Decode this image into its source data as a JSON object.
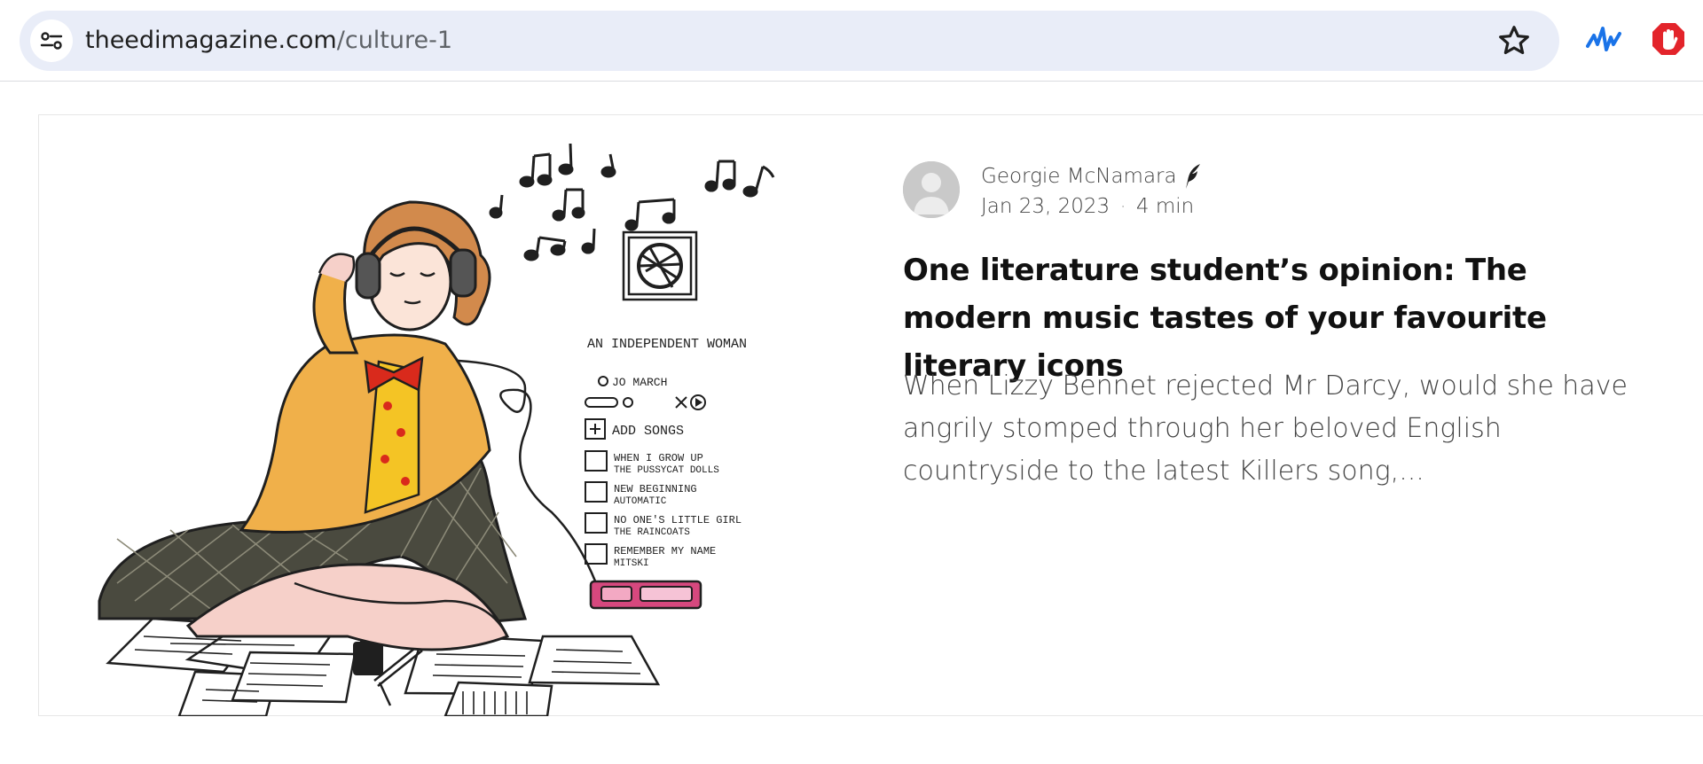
{
  "browser": {
    "url_host": "theedimagazine.com",
    "url_path": "/culture-1",
    "icons": {
      "site_settings": "tune-icon",
      "bookmark": "star-icon",
      "extension_1": "waveform-icon",
      "extension_2": "stop-hand-icon"
    }
  },
  "post": {
    "author": "Georgie McNamara",
    "author_badge": "quill-icon",
    "date": "Jan 23, 2023",
    "separator": "·",
    "read_time": "4 min",
    "title": "One literature student’s opinion: The modern music tastes of your favourite literary icons",
    "excerpt": "When Lizzy Bennet rejected Mr Darcy, would she have angrily stomped through her beloved English countryside to the latest Killers song,...",
    "illustration": {
      "playlist_title": "AN INDEPENDENT WOMAN",
      "playlist_owner": "JO MARCH",
      "add_songs": "ADD SONGS",
      "songs": [
        {
          "title": "WHEN I GROW UP",
          "artist": "THE PUSSYCAT DOLLS"
        },
        {
          "title": "NEW BEGINNING",
          "artist": "AUTOMATIC"
        },
        {
          "title": "NO ONE'S LITTLE GIRL",
          "artist": "THE RAINCOATS"
        },
        {
          "title": "REMEMBER MY NAME",
          "artist": "MITSKI"
        }
      ]
    }
  },
  "colors": {
    "omnibox": "#e9edf8",
    "extension_blue": "#1a73e8",
    "extension_red": "#e3242b",
    "jacket": "#f0b04a",
    "bow": "#d92a1c",
    "player": "#d6487e"
  }
}
